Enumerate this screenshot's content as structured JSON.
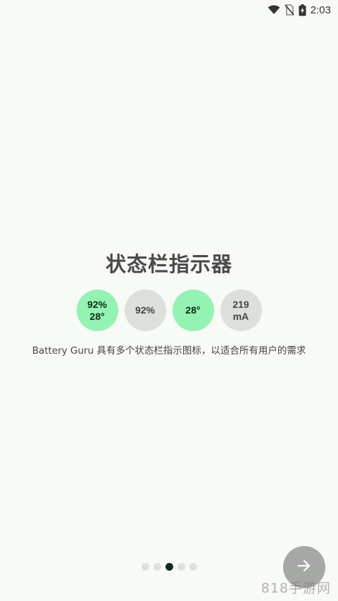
{
  "status_bar": {
    "time": "2:03",
    "icons": [
      "wifi-icon",
      "no-sim-icon",
      "battery-charging-icon"
    ]
  },
  "onboarding": {
    "title": "状态栏指示器",
    "indicators": [
      {
        "line1": "92%",
        "line2": "28°",
        "style": "green"
      },
      {
        "line1": "92%",
        "line2": "",
        "style": "grey"
      },
      {
        "line1": "28°",
        "line2": "",
        "style": "green"
      },
      {
        "line1": "219",
        "line2": "mA",
        "style": "grey"
      }
    ],
    "description": "Battery Guru 具有多个状态栏指示图标，以适合所有用户的需求"
  },
  "pager": {
    "total": 5,
    "active_index": 2
  },
  "next_button": {
    "icon": "arrow-right-icon"
  },
  "watermark": "818手游网",
  "colors": {
    "background": "#f8faf6",
    "green_indicator": "#92f3b2",
    "grey_indicator": "#dcdfda",
    "active_dot": "#0e2a1c",
    "next_button": "#a6a8a6"
  }
}
